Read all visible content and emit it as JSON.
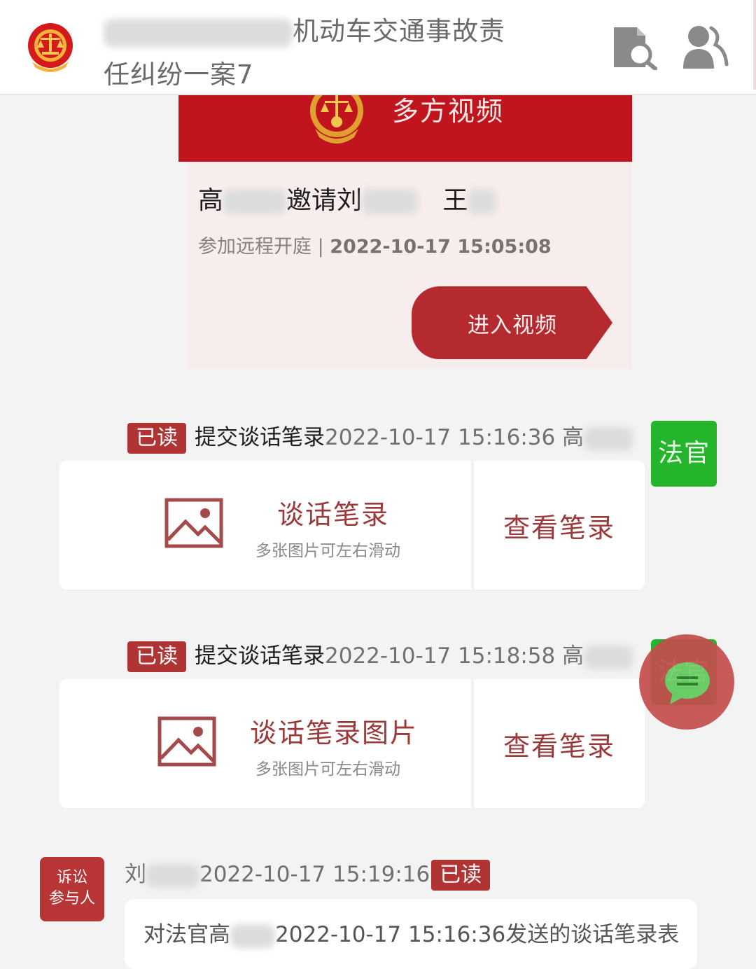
{
  "header": {
    "case_title_suffix": "机动车交通事故责",
    "case_title_line2": "任纠纷一案7",
    "icons": [
      "document-search-icon",
      "participants-icon"
    ]
  },
  "video_card": {
    "banner_title": "多方视频",
    "invite_prefix": "高",
    "invite_middle": "邀请刘",
    "invite_name2": "王",
    "meta_label": "参加远程开庭 | ",
    "meta_time": "2022-10-17 15:05:08",
    "enter_button": "进入视频"
  },
  "messages": [
    {
      "read_badge": "已读",
      "action": "提交谈话笔录",
      "timestamp": "2022-10-17 15:16:36 高",
      "sender_tag": "法官",
      "note_title": "谈话笔录",
      "note_subtitle": "多张图片可左右滑动",
      "view_button": "查看笔录"
    },
    {
      "read_badge": "已读",
      "action": "提交谈话笔录",
      "timestamp": "2022-10-17 15:18:58 高",
      "sender_tag": "法官",
      "note_title": "谈话笔录图片",
      "note_subtitle": "多张图片可左右滑动",
      "view_button": "查看笔录"
    }
  ],
  "party_message": {
    "tag_line1": "诉讼",
    "tag_line2": "参与人",
    "sender": "刘",
    "timestamp": "2022-10-17 15:19:16",
    "read_badge": "已读",
    "text_prefix": "对法官高",
    "text_suffix": "2022-10-17 15:16:36发送的谈话笔录表"
  },
  "colors": {
    "court_red": "#c1151e",
    "badge_red": "#b03434",
    "judge_green": "#25b52b",
    "note_text": "#9a3a3a"
  }
}
